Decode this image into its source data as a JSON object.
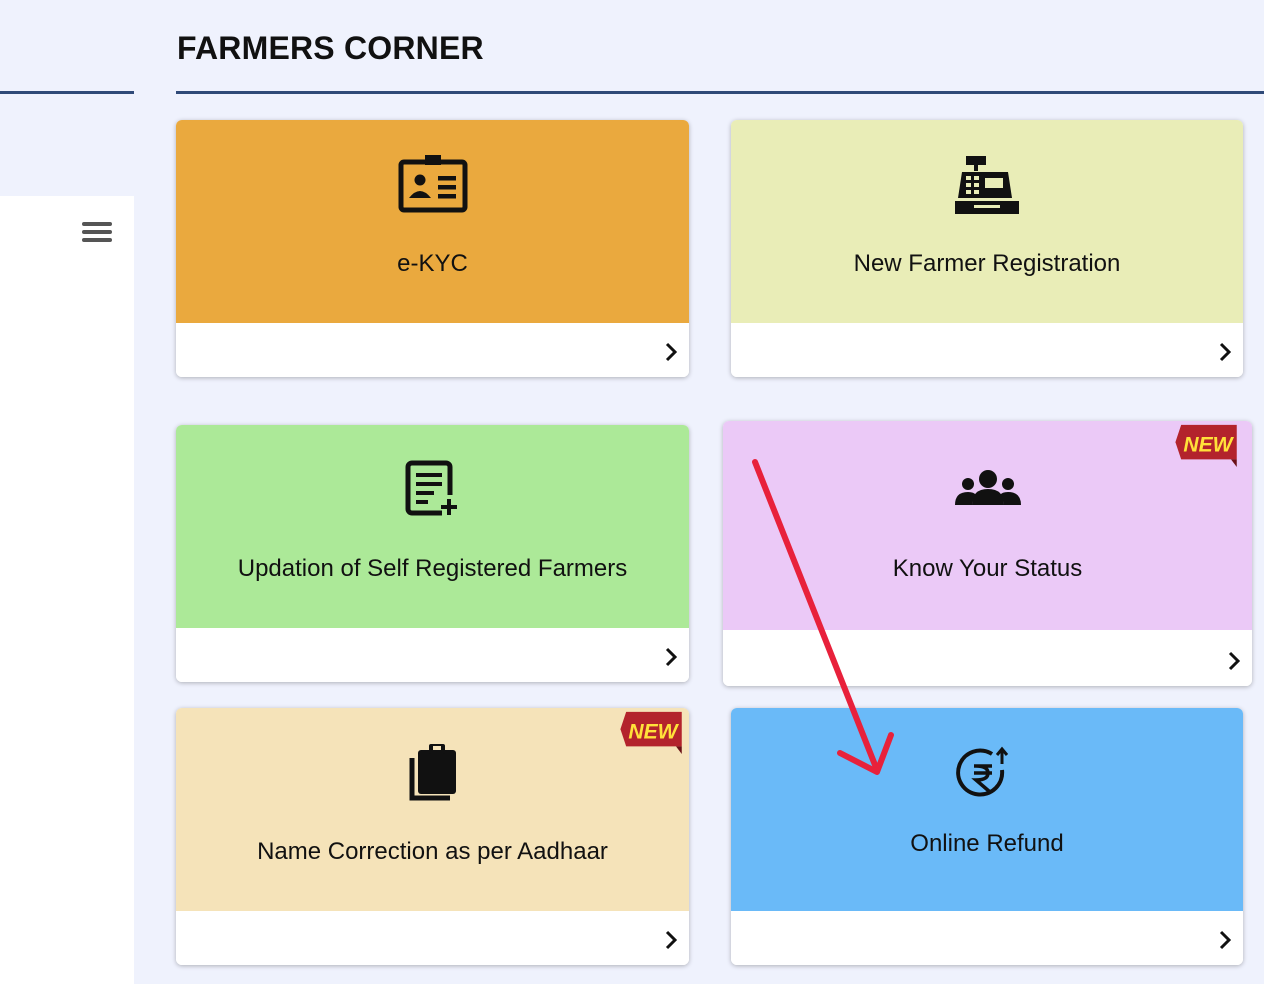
{
  "section": {
    "title": "FARMERS CORNER"
  },
  "cards": [
    {
      "label": "e-KYC",
      "icon": "id-card-icon",
      "bg": "#eaa93e",
      "badge": ""
    },
    {
      "label": "New Farmer Registration",
      "icon": "cash-register-icon",
      "bg": "#e9edb7",
      "badge": ""
    },
    {
      "label": "Updation of Self Registered Farmers",
      "icon": "edit-document-icon",
      "bg": "#ace998",
      "badge": ""
    },
    {
      "label": "Know Your Status",
      "icon": "users-group-icon",
      "bg": "#ebc9f7",
      "badge": "NEW"
    },
    {
      "label": "Name Correction as per Aadhaar",
      "icon": "clipboard-icon",
      "bg": "#f5e3b9",
      "badge": "NEW"
    },
    {
      "label": "Online Refund",
      "icon": "rupee-refund-icon",
      "bg": "#6abaf8",
      "badge": ""
    }
  ],
  "colors": {
    "accent_rule": "#2f4a78",
    "badge_red": "#b3232c",
    "badge_text": "#ffe13a",
    "annotation_arrow": "#e8213b"
  }
}
